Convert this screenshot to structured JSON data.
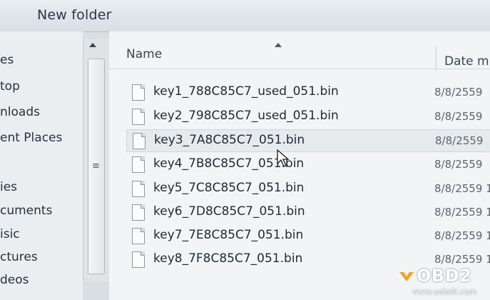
{
  "window": {
    "title": "New folder"
  },
  "nav": {
    "items": [
      {
        "label": "es"
      },
      {
        "label": "top"
      },
      {
        "label": "nloads"
      },
      {
        "label": "ent Places"
      },
      {
        "label": "ies"
      },
      {
        "label": "cuments"
      },
      {
        "label": "isic"
      },
      {
        "label": "ctures"
      },
      {
        "label": "deos"
      }
    ]
  },
  "list": {
    "columns": {
      "name": "Name",
      "date": "Date m"
    },
    "files": [
      {
        "name": "key1_788C85C7_used_051.bin",
        "date": "8/8/2559"
      },
      {
        "name": "key2_798C85C7_used_051.bin",
        "date": "8/8/2559"
      },
      {
        "name": "key3_7A8C85C7_051.bin",
        "date": "8/8/2559"
      },
      {
        "name": "key4_7B8C85C7_051.bin",
        "date": "8/8/2559"
      },
      {
        "name": "key5_7C8C85C7_051.bin",
        "date": "8/8/2559 1"
      },
      {
        "name": "key6_7D8C85C7_051.bin",
        "date": "8/8/2559 1"
      },
      {
        "name": "key7_7E8C85C7_051.bin",
        "date": "8/8/2559 1"
      },
      {
        "name": "key8_7F8C85C7_051.bin",
        "date": "8/8/2559 1"
      }
    ]
  },
  "watermark": {
    "brand": "OBD2",
    "url": "www.uobdii.com",
    "accent": "#f2a31b"
  },
  "icons": {
    "file": "file-icon",
    "scroll_up": "arrow-up-icon",
    "sort": "sort-ascending-icon",
    "cursor": "mouse-pointer-icon"
  }
}
